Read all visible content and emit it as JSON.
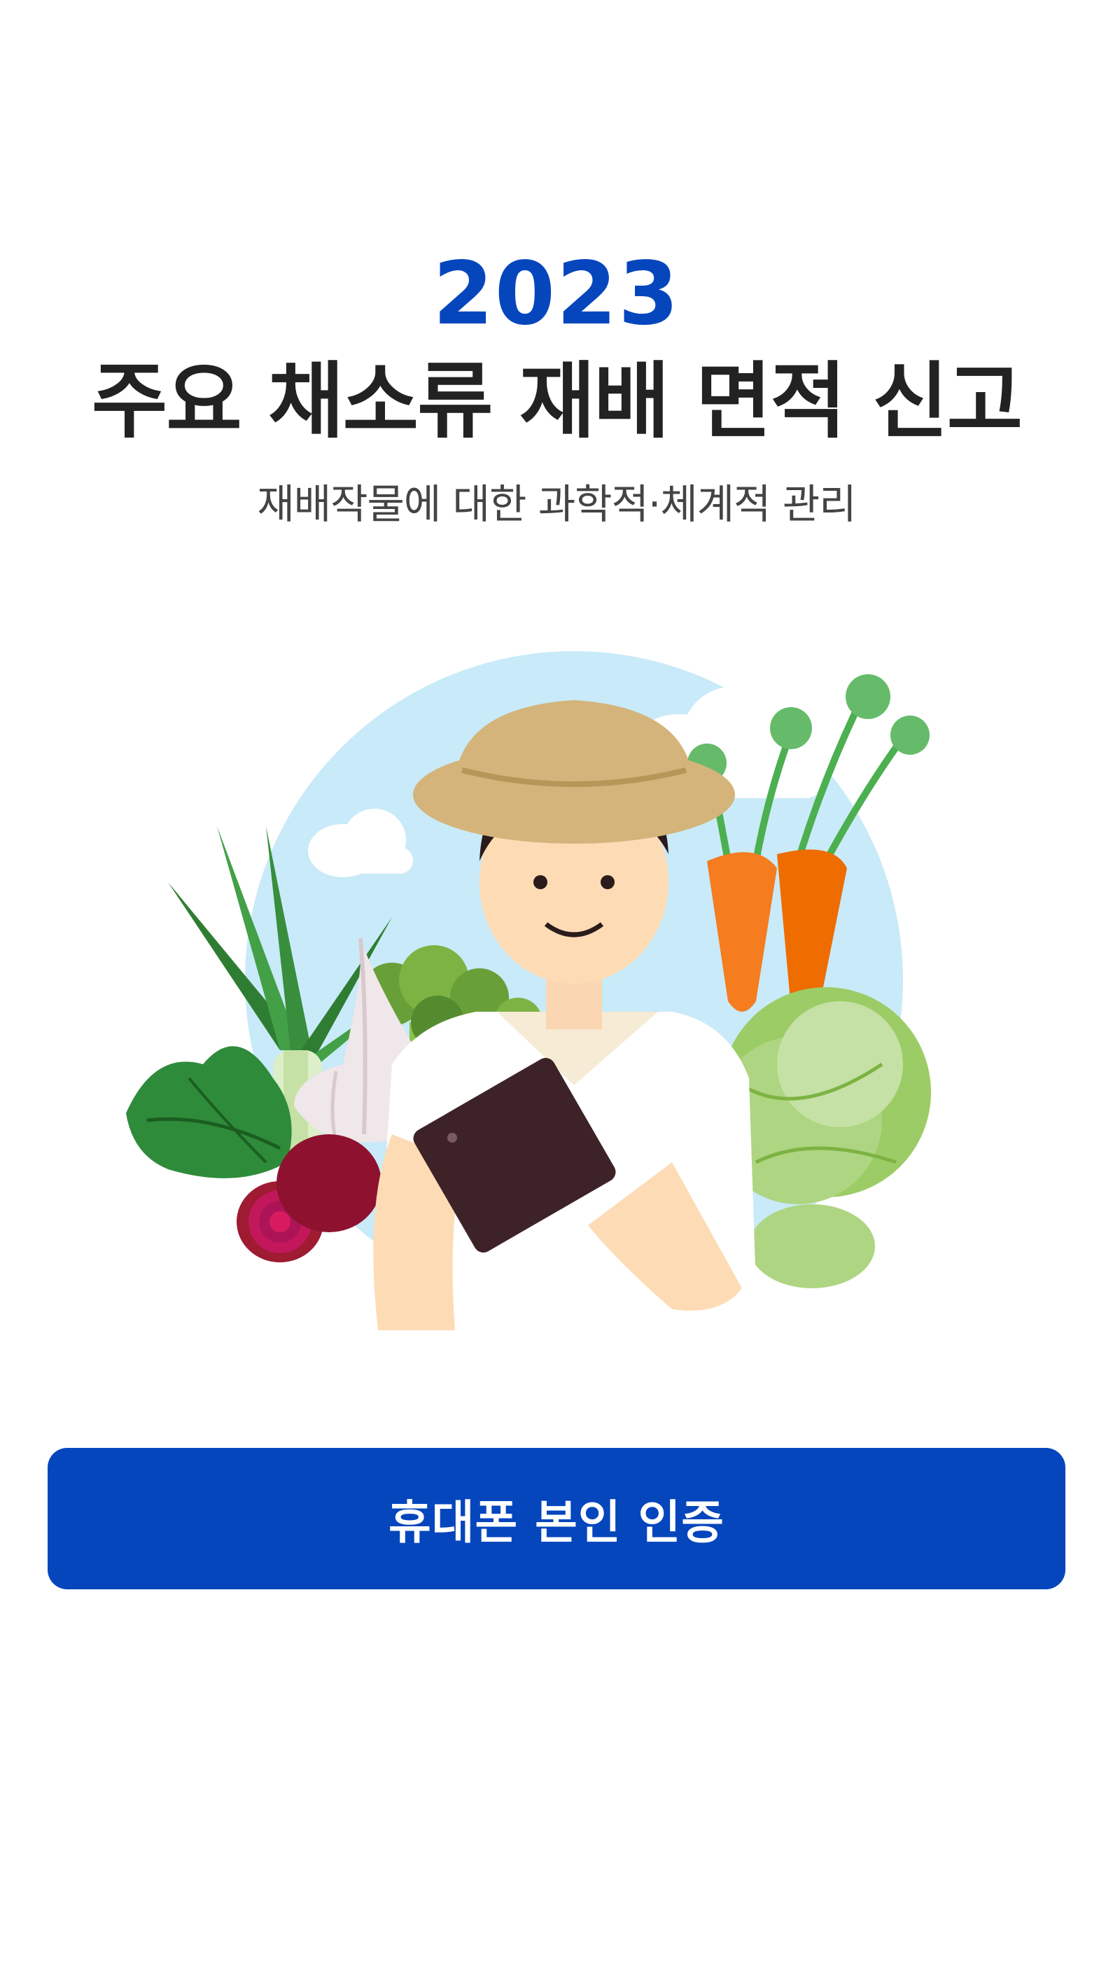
{
  "header": {
    "year": "2023",
    "title": "주요 채소류 재배 면적 신고",
    "subtitle": "재배작물에 대한 과학적·체계적 관리"
  },
  "actions": {
    "auth_button_label": "휴대폰 본인 인증"
  },
  "illustration": {
    "icon": "farmer-with-tablet-and-vegetables"
  },
  "colors": {
    "brand_blue": "#0546BD",
    "title_text": "#222222",
    "subtitle_text": "#444444",
    "sky": "#C9EAF8"
  }
}
